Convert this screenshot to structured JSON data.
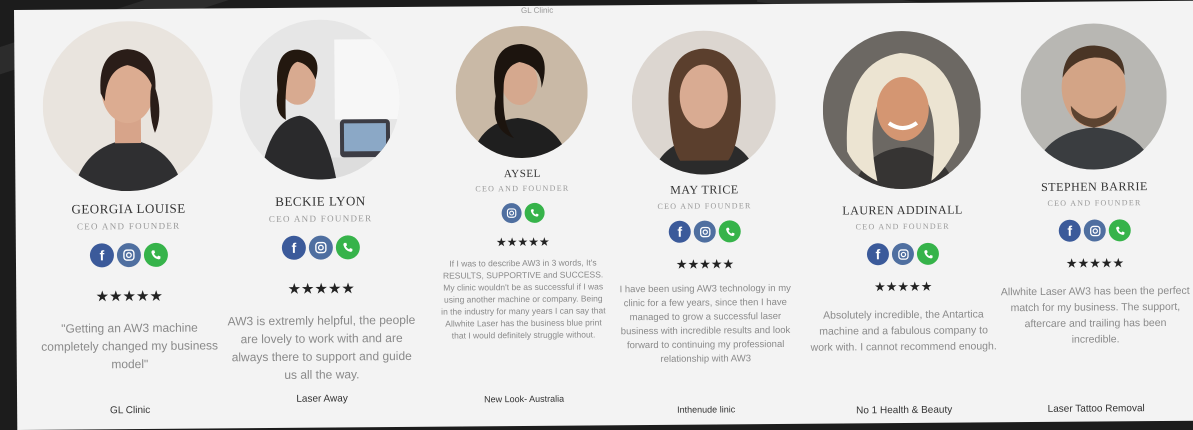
{
  "top_text": "GL Clinic",
  "cards": [
    {
      "name": "GEORGIA LOUISE",
      "title": "CEO AND FOUNDER",
      "socials": [
        "facebook-icon",
        "instagram-icon",
        "phone-icon"
      ],
      "stars": "★★★★★",
      "review": "\"Getting an AW3 machine completely changed my business model\"",
      "company": "GL Clinic"
    },
    {
      "name": "BECKIE LYON",
      "title": "CEO AND FOUNDER",
      "socials": [
        "facebook-icon",
        "instagram-icon",
        "phone-icon"
      ],
      "stars": "★★★★★",
      "review": "AW3 is extremly helpful, the people are lovely to work with and are always there to support and guide us all the way.",
      "company": "Laser Away"
    },
    {
      "name": "AYSEL",
      "title": "CEO AND FOUNDER",
      "socials": [
        "instagram-icon",
        "phone-icon"
      ],
      "stars": "★★★★★",
      "review": "If I was to describe AW3 in 3 words, It's RESULTS, SUPPORTIVE and SUCCESS. My clinic wouldn't be as successful if I was using another machine or company. Being in the industry for many years I can say that Allwhite Laser has the business blue print that I would definitely struggle without.",
      "company": "New Look- Australia"
    },
    {
      "name": "MAY TRICE",
      "title": "CEO AND FOUNDER",
      "socials": [
        "facebook-icon",
        "instagram-icon",
        "phone-icon"
      ],
      "stars": "★★★★★",
      "review": "I have been using AW3 technology in my clinic for a few years, since then I have managed to grow a successful laser business with incredible results and look forward to continuing my professional relationship with AW3",
      "company": "Inthenude linic"
    },
    {
      "name": "LAUREN ADDINALL",
      "title": "CEO AND FOUNDER",
      "socials": [
        "facebook-icon",
        "instagram-icon",
        "phone-icon"
      ],
      "stars": "★★★★★",
      "review": "Absolutely incredible, the Antartica machine and a fabulous company to work with. I cannot recommend enough.",
      "company": "No 1 Health & Beauty"
    },
    {
      "name": "STEPHEN BARRIE",
      "title": "CEO AND FOUNDER",
      "socials": [
        "facebook-icon",
        "instagram-icon",
        "phone-icon"
      ],
      "stars": "★★★★★",
      "review": "Allwhite Laser AW3 has been the perfect match for my business. The support, aftercare and trailing has been incredible.",
      "company": "Laser Tattoo Removal"
    }
  ]
}
